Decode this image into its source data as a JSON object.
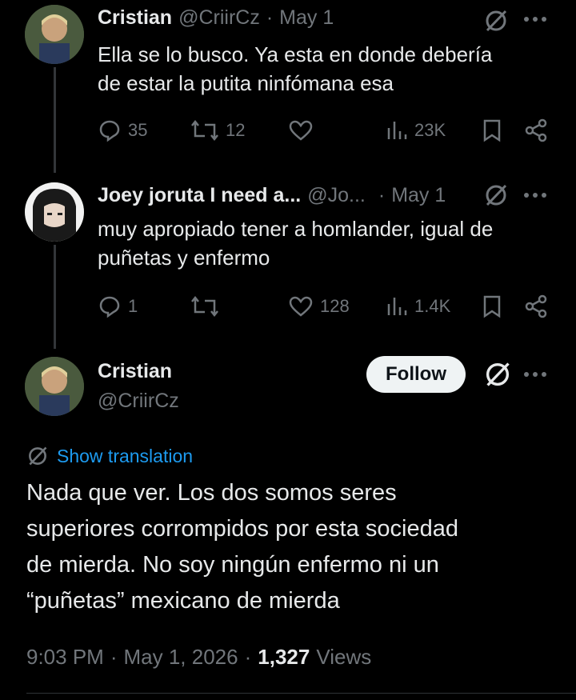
{
  "tweet1": {
    "name": "Cristian",
    "handle": "@CriirCz",
    "sep": "·",
    "date": "May 1",
    "text_line1": "Ella se lo busco. Ya esta en donde debería",
    "text_line2": "de estar la putita ninfómana esa",
    "replies": "35",
    "retweets": "12",
    "views": "23K"
  },
  "tweet2": {
    "name": "Joey joruta I need a...",
    "handle": "@Jo...",
    "sep": "·",
    "date": "May 1",
    "text_line1": "muy apropiado tener a homlander, igual de",
    "text_line2": "puñetas y enfermo",
    "replies": "1",
    "likes": "128",
    "views": "1.4K"
  },
  "main_tweet": {
    "name": "Cristian",
    "handle": "@CriirCz",
    "follow_label": "Follow",
    "translation_label": "Show translation",
    "text_lines": [
      "Nada que ver. Los dos somos seres",
      "superiores corrompidos por esta sociedad",
      "de mierda. No soy ningún enfermo ni un",
      "“puñetas” mexicano de mierda"
    ],
    "time": "9:03 PM",
    "sep": "·",
    "full_date": "May 1, 2026",
    "views_count": "1,327",
    "views_label": "Views"
  },
  "colors": {
    "accent": "#1d9bf0",
    "muted": "#71767b",
    "text": "#e7e9ea",
    "bg": "#000000"
  }
}
